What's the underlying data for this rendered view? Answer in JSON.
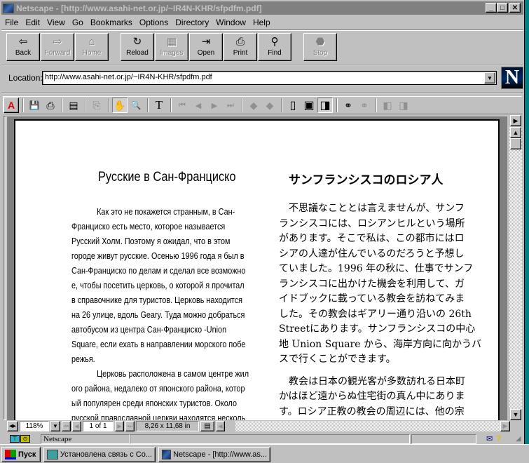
{
  "window": {
    "title": "Netscape - [http://www.asahi-net.or.jp/~IR4N-KHR/sfpdfm.pdf]",
    "controls": {
      "minimize": "_",
      "maximize": "□",
      "close": "✕"
    }
  },
  "menu": [
    "File",
    "Edit",
    "View",
    "Go",
    "Bookmarks",
    "Options",
    "Directory",
    "Window",
    "Help"
  ],
  "toolbar": {
    "buttons": [
      {
        "label": "Back",
        "icon": "back-arrow-icon",
        "glyph": "⇦",
        "enabled": true
      },
      {
        "label": "Forward",
        "icon": "forward-arrow-icon",
        "glyph": "⇨",
        "enabled": false
      },
      {
        "label": "Home",
        "icon": "home-icon",
        "glyph": "⌂",
        "enabled": false
      },
      {
        "label": "Reload",
        "icon": "reload-icon",
        "glyph": "↻",
        "enabled": true
      },
      {
        "label": "Images",
        "icon": "images-icon",
        "glyph": "▦",
        "enabled": false
      },
      {
        "label": "Open",
        "icon": "open-icon",
        "glyph": "⇥",
        "enabled": true
      },
      {
        "label": "Print",
        "icon": "print-icon",
        "glyph": "⎙",
        "enabled": true
      },
      {
        "label": "Find",
        "icon": "find-icon",
        "glyph": "⚲",
        "enabled": true
      },
      {
        "label": "Stop",
        "icon": "stop-icon",
        "glyph": "⬣",
        "enabled": false
      }
    ]
  },
  "location": {
    "label": "Location:",
    "value": "http://www.asahi-net.or.jp/~IR4N-KHR/sfpdfm.pdf",
    "logo": "N"
  },
  "pdf_toolbar": {
    "acrobat": "A",
    "save": "💾",
    "print": "⎙",
    "thumbnails": "▤",
    "copy": "⎘",
    "hand": "✋",
    "zoom": "🔍",
    "text_select": "T",
    "first": "⏮",
    "prev": "◀",
    "next": "▶",
    "last": "⏭",
    "back": "◆",
    "forward": "◆",
    "actual_size": "▯",
    "fit_page": "▣",
    "fit_width": "◨",
    "find": "⚭",
    "find_again": "⚭",
    "prev_doc": "◧",
    "next_doc": "◨"
  },
  "document": {
    "ru_title": "Русские в Сан-Франциско",
    "ja_title": "サンフランシスコのロシア人",
    "ru_lines": [
      "            Как это не покажется странным, в Сан-",
      "Франциско есть место, которое называется",
      "Русский Холм. Поэтому я ожидал, что в этом",
      "городе живут русские. Осенью 1996 года я был в",
      "Сан-Франциско по делам и сделал все возможно",
      "е, чтобы посетить церковь, о которой я прочитал",
      "в справочнике для туристов. Церковь находится",
      "на 26 улице, вдоль Geary. Туда можно добраться",
      "автобусом из центра Сан-Франциско -Union",
      "Square, если ехать в направлении морского побе",
      "режья.",
      "            Церковь расположена в самом центре жил",
      "ого района, недалеко от японского района, котор",
      "ый популярен среди японских туристов. Около",
      "русской православной церкви находятся несколь"
    ],
    "ja_lines": [
      "　不思議なこととは言えませんが、サンフ",
      "ランシスコには、ロシアンヒルという場所",
      "があります。そこで私は、この都市にはロ",
      "シアの人達が住んでいるのだろうと予想し",
      "ていました。1996 年の秋に、仕事でサンフ",
      "ランシスコに出かけた機会を利用して、ガ",
      "イドブックに載っている教会を訪ねてみま",
      "した。その教会はギアリー通り沿いの 26th",
      "Streetにあります。サンフランシスコの中心",
      "地 Union Square から、海岸方向に向かうバ",
      "スで行くことができます。",
      "",
      "　教会は日本の観光客が多数訪れる日本町",
      "かはほど遠からぬ住宅街の真ん中にありま",
      "す。ロシア正教の教会の周辺には、他の宗"
    ]
  },
  "pdf_status": {
    "zoom": "118%",
    "page": "1 of 1",
    "page_size": "8,26 x 11,68 in"
  },
  "status_bar": {
    "text": "Netscape"
  },
  "taskbar": {
    "start": "Пуск",
    "tasks": [
      {
        "label": "Установлена связь с Co...",
        "icon": "dialup-connection-icon"
      },
      {
        "label": "Netscape - [http://www.as...",
        "icon": "netscape-icon"
      }
    ]
  }
}
